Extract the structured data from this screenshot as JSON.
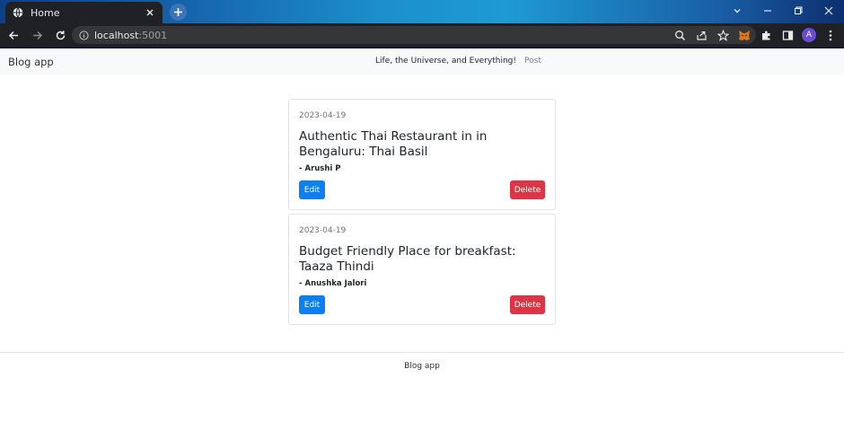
{
  "browser": {
    "tab_title": "Home",
    "url_host": "localhost",
    "url_port": ":5001",
    "profile_initial": "A"
  },
  "navbar": {
    "brand": "Blog app",
    "links": [
      "Life, the Universe, and Everything!",
      "Post"
    ]
  },
  "posts": [
    {
      "date": "2023-04-19",
      "title": "Authentic Thai Restaurant in in Bengaluru: Thai Basil",
      "author": "- Arushi P",
      "edit_label": "Edit",
      "delete_label": "Delete"
    },
    {
      "date": "2023-04-19",
      "title": "Budget Friendly Place for breakfast: Taaza Thindi",
      "author": "- Anushka Jalori",
      "edit_label": "Edit",
      "delete_label": "Delete"
    }
  ],
  "footer": {
    "text": "Blog app"
  },
  "colors": {
    "edit_button": "#0d7ff0",
    "delete_button": "#dc3545",
    "navbar_bg": "#f8f9fa"
  }
}
